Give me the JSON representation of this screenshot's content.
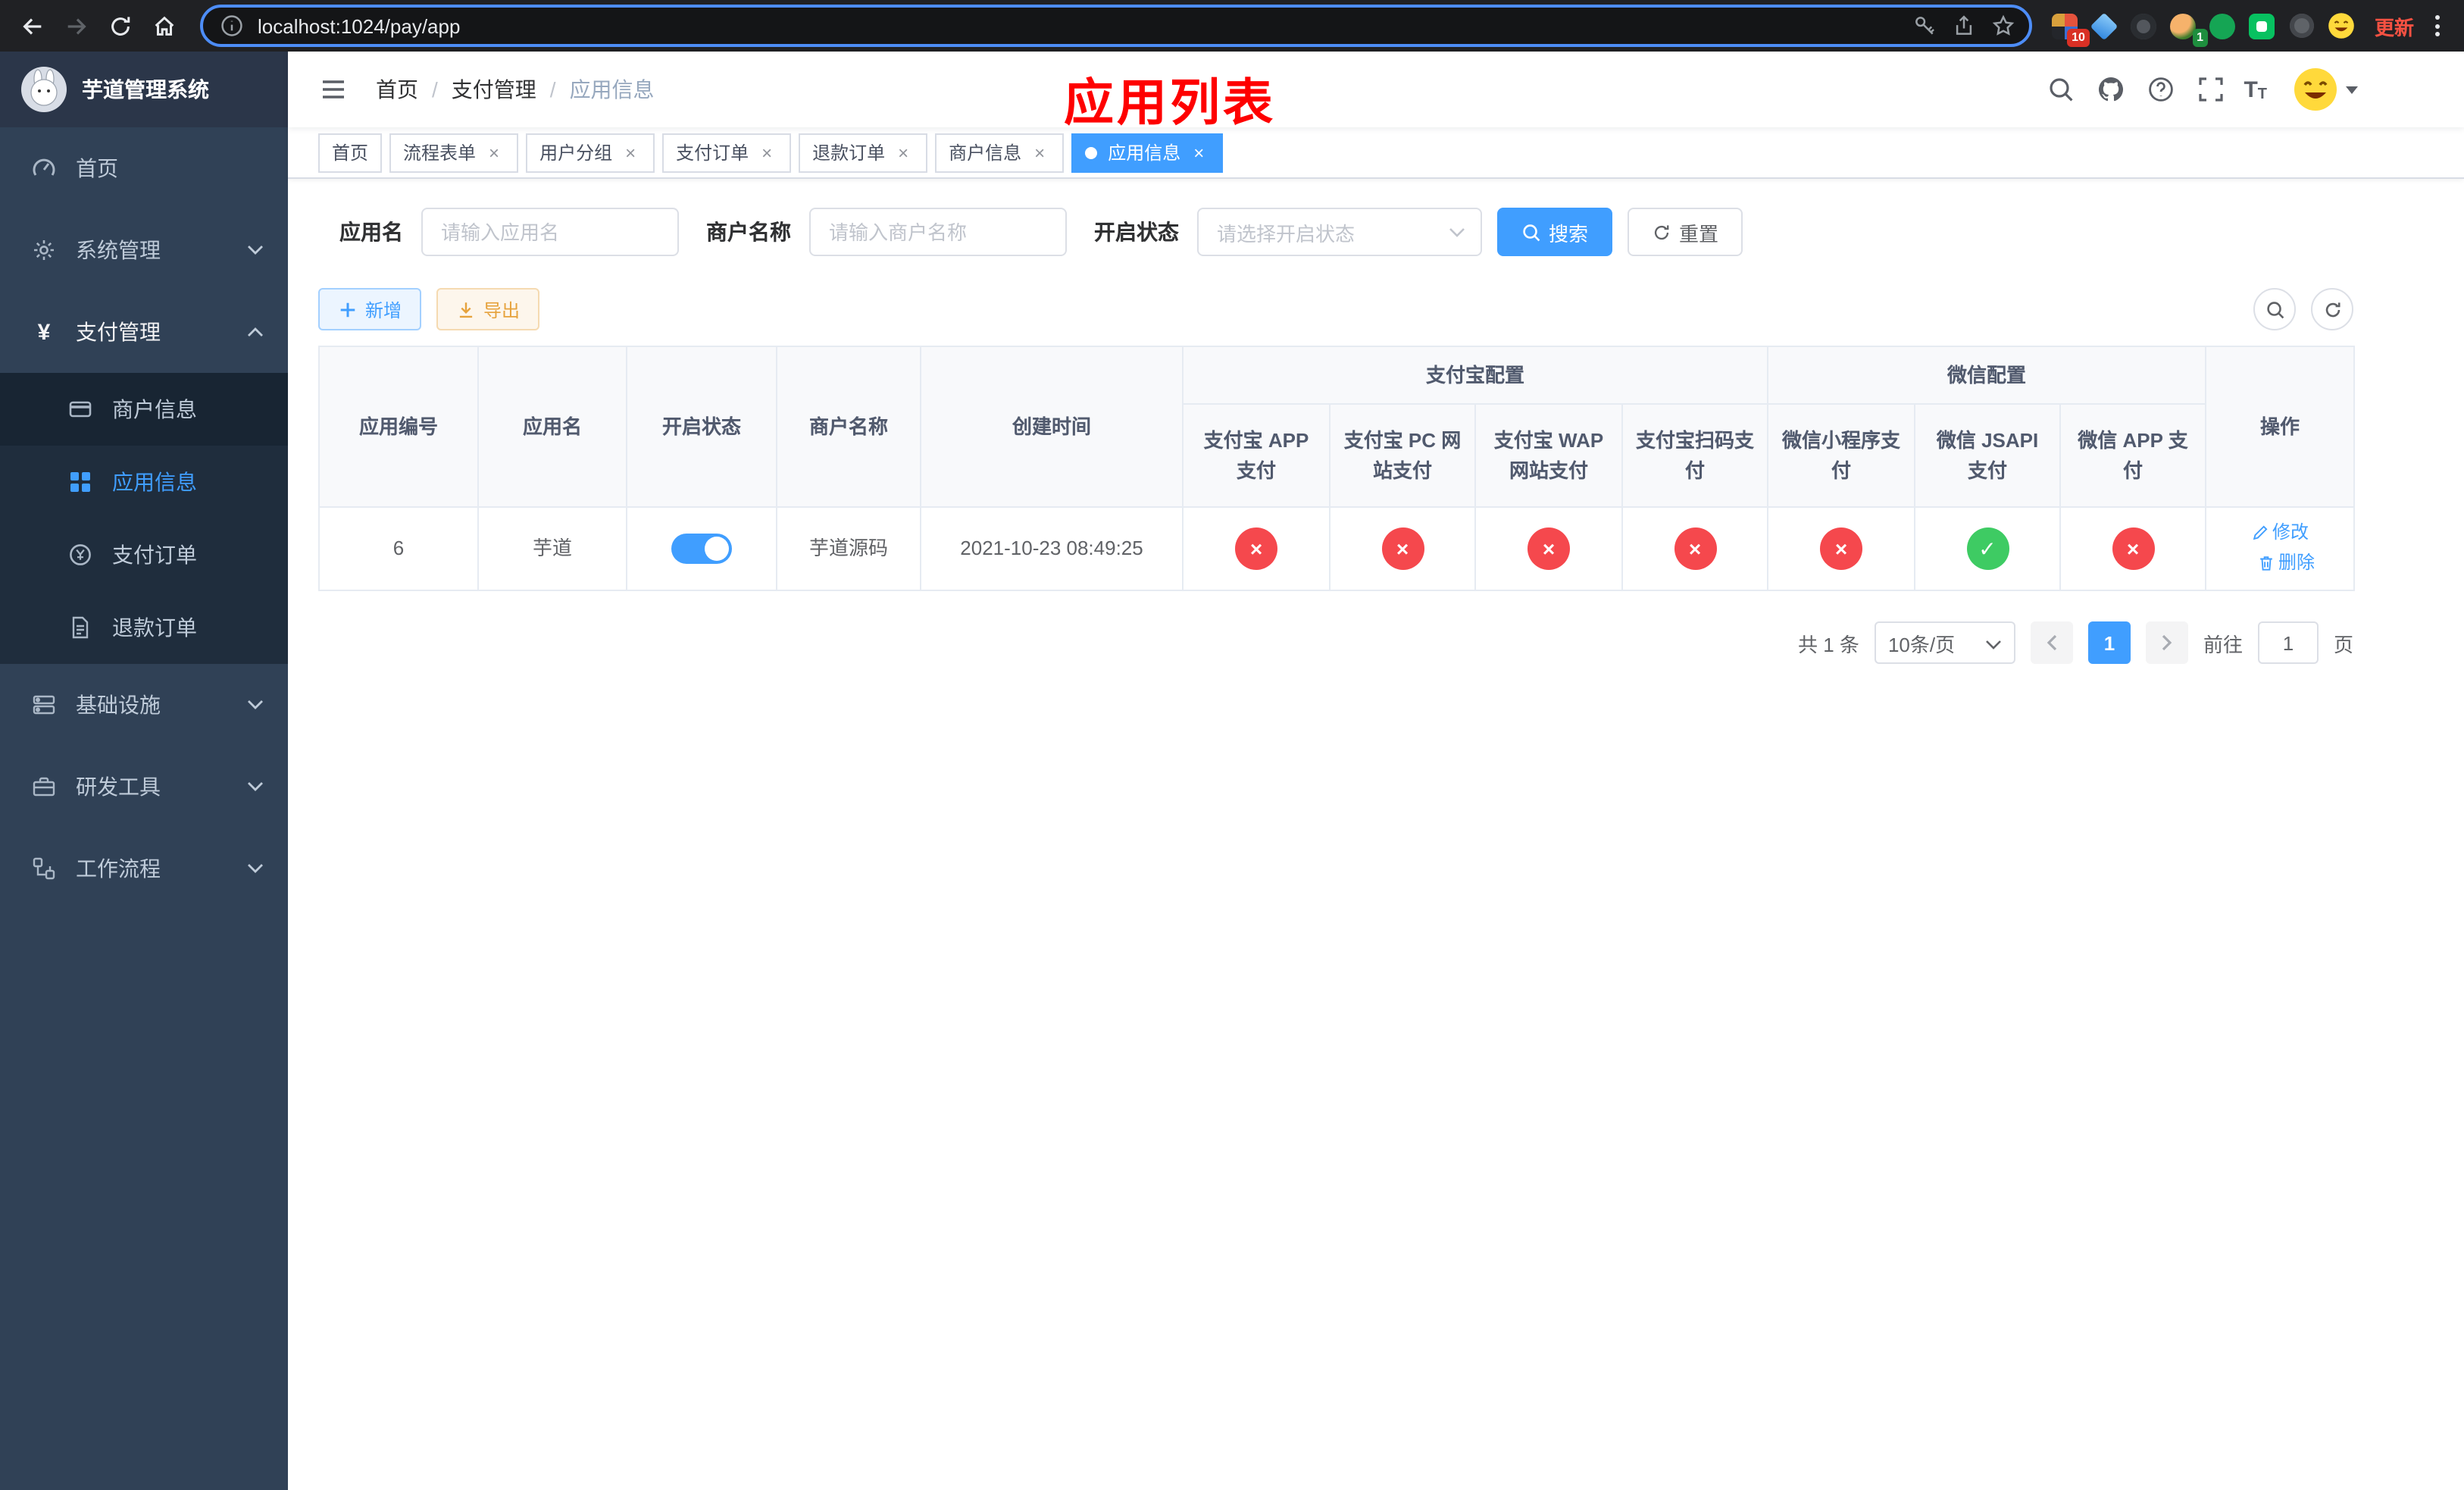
{
  "colors": {
    "primary": "#409eff",
    "success": "#3ecb63",
    "danger": "#f5484d",
    "sidebar_bg": "#304156",
    "submenu_bg": "#1f2d3d",
    "annotation_red": "#fe0000",
    "active_tab": "#409eff"
  },
  "browser": {
    "url": "localhost:1024/pay/app",
    "update_label": "更新",
    "grid_ext_badge": "10",
    "avatar_ext_badge": "1"
  },
  "icons": {
    "close": "×",
    "question": "?",
    "font_big": "T",
    "font_small": "T",
    "yen": "¥",
    "plus": "+"
  },
  "sidebar": {
    "title": "芋道管理系统",
    "home": "首页",
    "system": "系统管理",
    "payment": "支付管理",
    "merchant_info": "商户信息",
    "app_info": "应用信息",
    "pay_order": "支付订单",
    "refund_order": "退款订单",
    "infrastructure": "基础设施",
    "devtools": "研发工具",
    "workflow": "工作流程"
  },
  "navbar": {
    "breadcrumb": [
      "首页",
      "支付管理",
      "应用信息"
    ],
    "separator": "/",
    "annotation": "应用列表"
  },
  "tabs": [
    {
      "label": "首页"
    },
    {
      "label": "流程表单"
    },
    {
      "label": "用户分组"
    },
    {
      "label": "支付订单"
    },
    {
      "label": "退款订单"
    },
    {
      "label": "商户信息"
    },
    {
      "label": "应用信息"
    }
  ],
  "filters": {
    "app_name_label": "应用名",
    "app_name_placeholder": "请输入应用名",
    "merchant_label": "商户名称",
    "merchant_placeholder": "请输入商户名称",
    "status_label": "开启状态",
    "status_placeholder": "请选择开启状态",
    "search_label": "搜索",
    "reset_label": "重置"
  },
  "toolbar": {
    "add_label": "新增",
    "export_label": "导出"
  },
  "table": {
    "status_icons": {
      "ok": "✓",
      "fail": "×"
    },
    "columns": {
      "id": "应用编号",
      "name": "应用名",
      "status": "开启状态",
      "merchant": "商户名称",
      "created": "创建时间",
      "alipay_group": "支付宝配置",
      "wechat_group": "微信配置",
      "alipay_app": "支付宝 APP 支付",
      "alipay_pc": "支付宝 PC 网站支付",
      "alipay_wap": "支付宝 WAP 网站支付",
      "alipay_qr": "支付宝扫码支付",
      "wx_lite": "微信小程序支付",
      "wx_jsapi": "微信 JSAPI 支付",
      "wx_app": "微信 APP 支付",
      "actions": "操作"
    },
    "rows": [
      {
        "id": "6",
        "name": "芋道",
        "enabled": true,
        "merchant": "芋道源码",
        "created": "2021-10-23 08:49:25",
        "alipay_app": false,
        "alipay_pc": false,
        "alipay_wap": false,
        "alipay_qr": false,
        "wx_lite": false,
        "wx_jsapi": true,
        "wx_app": false,
        "edit_label": "修改",
        "delete_label": "删除"
      }
    ]
  },
  "pagination": {
    "total": "共 1 条",
    "page_size": "10条/页",
    "page": "1",
    "goto_label": "前往",
    "goto_value": "1",
    "page_unit": "页"
  }
}
